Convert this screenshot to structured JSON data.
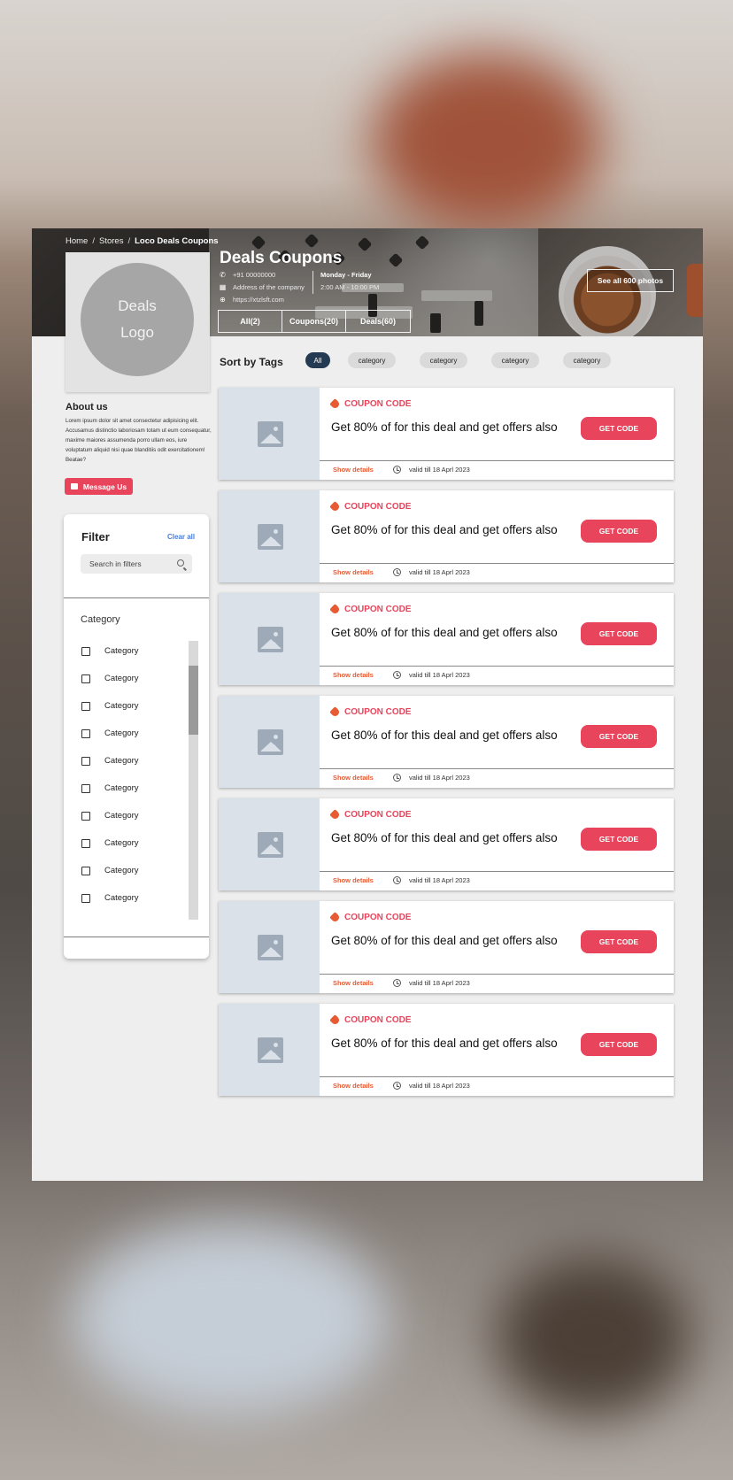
{
  "breadcrumb": {
    "home": "Home",
    "stores": "Stores",
    "current": "Loco Deals Coupons",
    "separator": "/"
  },
  "logo": {
    "line1": "Deals",
    "line2": "Logo"
  },
  "store": {
    "title": "Deals Coupons",
    "phone": "+91 00000000",
    "address": "Address of the company",
    "website": "https://xtzlsft.com",
    "hours_days": "Monday - Friday",
    "hours_time": "2:00 AM  -  10:00 PM"
  },
  "tabs": [
    {
      "label": "All(2)"
    },
    {
      "label": "Coupons(20)"
    },
    {
      "label": "Deals(60)"
    }
  ],
  "photos_button": "See all 600 photos",
  "about": {
    "title": "About us",
    "text": "Lorem ipsum dolor sit amet consectetur adipisicing elit. Accusamus distinctio laboriosam totam ut eum consequatur, maxime maiores assumenda porro ullam eos, iure voluptatum aliquid nisi quae blanditiis odit exercitationem! Beatae?",
    "message_button": "Message Us"
  },
  "filter": {
    "title": "Filter",
    "clear_all": "Clear all",
    "search_placeholder": "Search in filters",
    "category_heading": "Category",
    "items": [
      "Category",
      "Category",
      "Category",
      "Category",
      "Category",
      "Category",
      "Category",
      "Category",
      "Category",
      "Category"
    ]
  },
  "sort": {
    "title": "Sort by Tags",
    "tags": [
      "All",
      "category",
      "category",
      "category",
      "category"
    ]
  },
  "deals": [
    {
      "badge": "COUPON CODE",
      "title": "Get 80% of for this deal and get offers also",
      "button": "GET CODE",
      "details": "Show details",
      "valid": "valid till 18 Aprl 2023"
    },
    {
      "badge": "COUPON CODE",
      "title": "Get 80% of for this deal and get offers also",
      "button": "GET CODE",
      "details": "Show details",
      "valid": "valid till 18 Aprl 2023"
    },
    {
      "badge": "COUPON CODE",
      "title": "Get 80% of for this deal and get offers also",
      "button": "GET CODE",
      "details": "Show details",
      "valid": "valid till 18 Aprl 2023"
    },
    {
      "badge": "COUPON CODE",
      "title": "Get 80% of for this deal and get offers also",
      "button": "GET CODE",
      "details": "Show details",
      "valid": "valid till 18 Aprl 2023"
    },
    {
      "badge": "COUPON CODE",
      "title": "Get 80% of for this deal and get offers also",
      "button": "GET CODE",
      "details": "Show details",
      "valid": "valid till 18 Aprl 2023"
    },
    {
      "badge": "COUPON CODE",
      "title": "Get 80% of for this deal and get offers also",
      "button": "GET CODE",
      "details": "Show details",
      "valid": "valid till 18 Aprl 2023"
    },
    {
      "badge": "COUPON CODE",
      "title": "Get 80% of for this deal and get offers also",
      "button": "GET CODE",
      "details": "Show details",
      "valid": "valid till 18 Aprl 2023"
    }
  ],
  "colors": {
    "accent": "#e8455c",
    "details": "#e85a32",
    "active_tag": "#243a52",
    "link": "#4a7dd8"
  }
}
